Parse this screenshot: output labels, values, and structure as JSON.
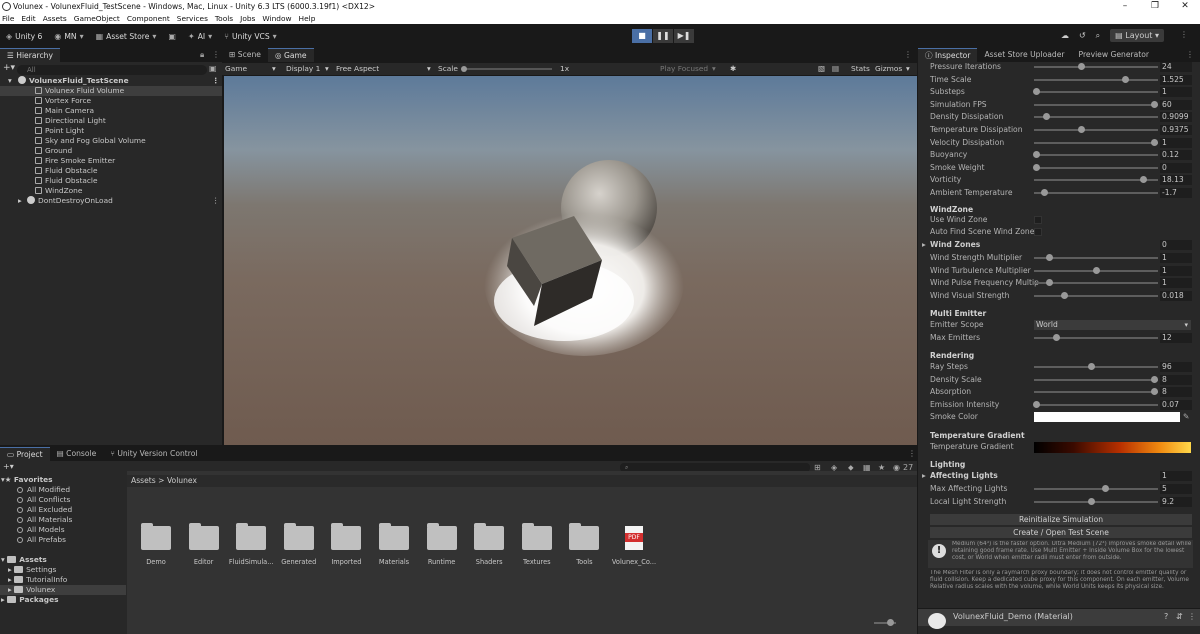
{
  "window": {
    "title": "Volunex - VolunexFluid_TestScene - Windows, Mac, Linux - Unity 6.3 LTS (6000.3.19f1) <DX12>"
  },
  "menu": [
    "File",
    "Edit",
    "Assets",
    "GameObject",
    "Component",
    "Services",
    "Tools",
    "Jobs",
    "Window",
    "Help"
  ],
  "toolbar": {
    "unity": "Unity 6",
    "account": "MN",
    "asset_store": "Asset Store",
    "ai": "AI",
    "vcs": "Unity VCS",
    "layout": "Layout"
  },
  "hierarchy": {
    "tab": "Hierarchy",
    "search_placeholder": "All",
    "scene": "VolunexFluid_TestScene",
    "items": [
      "Volunex Fluid Volume",
      "Vortex Force",
      "Main Camera",
      "Directional Light",
      "Point Light",
      "Sky and Fog Global Volume",
      "Ground",
      "Fire Smoke Emitter",
      "Fluid Obstacle",
      "Fluid Obstacle",
      "WindZone"
    ],
    "dontdestroy": "DontDestroyOnLoad"
  },
  "scene_tabs": {
    "scene": "Scene",
    "game": "Game"
  },
  "gamebar": {
    "game": "Game",
    "display": "Display 1",
    "aspect": "Free Aspect",
    "scale_label": "Scale",
    "scale_value": "1x",
    "play_focused": "Play Focused",
    "stats": "Stats",
    "gizmos": "Gizmos"
  },
  "project": {
    "tabs": [
      "Project",
      "Console",
      "Unity Version Control"
    ],
    "favorites_label": "Favorites",
    "favorites": [
      "All Modified",
      "All Conflicts",
      "All Excluded",
      "All Materials",
      "All Models",
      "All Prefabs"
    ],
    "assets_label": "Assets",
    "asset_children": [
      "Settings",
      "TutorialInfo",
      "Volunex"
    ],
    "packages_label": "Packages",
    "breadcrumb_root": "Assets",
    "breadcrumb_sep": ">",
    "breadcrumb_leaf": "Volunex",
    "folders": [
      "Demo",
      "Editor",
      "FluidSimula...",
      "Generated",
      "Imported",
      "Materials",
      "Runtime",
      "Shaders",
      "Textures",
      "Tools"
    ],
    "pdf": "Volunex_Co...",
    "pdf_badge": "PDF",
    "hidden_count": "27"
  },
  "inspector": {
    "tabs": [
      "Inspector",
      "Asset Store Uploader",
      "Preview Generator"
    ],
    "rows1": [
      {
        "label": "Pressure Iterations",
        "value": "24",
        "pos": 0.38
      },
      {
        "label": "Time Scale",
        "value": "1.525",
        "pos": 0.73
      },
      {
        "label": "Substeps",
        "value": "1",
        "pos": 0.02
      },
      {
        "label": "Simulation FPS",
        "value": "60",
        "pos": 0.97
      },
      {
        "label": "Density Dissipation",
        "value": "0.9099",
        "pos": 0.1
      },
      {
        "label": "Temperature Dissipation",
        "value": "0.9375",
        "pos": 0.38
      },
      {
        "label": "Velocity Dissipation",
        "value": "1",
        "pos": 0.97
      },
      {
        "label": "Buoyancy",
        "value": "0.12",
        "pos": 0.02
      },
      {
        "label": "Smoke Weight",
        "value": "0",
        "pos": 0.02
      },
      {
        "label": "Vorticity",
        "value": "18.13",
        "pos": 0.88
      },
      {
        "label": "Ambient Temperature",
        "value": "-1.7",
        "pos": 0.08
      }
    ],
    "windzone_title": "WindZone",
    "use_wind_zone": "Use Wind Zone",
    "auto_find": "Auto Find Scene Wind Zones",
    "wind_zones": {
      "label": "Wind Zones",
      "value": "0"
    },
    "rows2": [
      {
        "label": "Wind Strength Multiplier",
        "value": "1",
        "pos": 0.12
      },
      {
        "label": "Wind Turbulence Multiplier",
        "value": "1",
        "pos": 0.5
      },
      {
        "label": "Wind Pulse Frequency Multip",
        "value": "1",
        "pos": 0.12
      },
      {
        "label": "Wind Visual Strength",
        "value": "0.018",
        "pos": 0.24
      }
    ],
    "multi_title": "Multi Emitter",
    "emitter_scope": {
      "label": "Emitter Scope",
      "value": "World"
    },
    "max_emitters": {
      "label": "Max Emitters",
      "value": "12",
      "pos": 0.18
    },
    "render_title": "Rendering",
    "rows3": [
      {
        "label": "Ray Steps",
        "value": "96",
        "pos": 0.46
      },
      {
        "label": "Density Scale",
        "value": "8",
        "pos": 0.97
      },
      {
        "label": "Absorption",
        "value": "8",
        "pos": 0.97
      },
      {
        "label": "Emission Intensity",
        "value": "0.07",
        "pos": 0.02
      }
    ],
    "smoke_color": {
      "label": "Smoke Color",
      "color": "#ffffff"
    },
    "gradient_title": "Temperature Gradient",
    "gradient_label": "Temperature Gradient",
    "lighting_title": "Lighting",
    "affecting": {
      "label": "Affecting Lights",
      "value": "1"
    },
    "rows4": [
      {
        "label": "Max Affecting Lights",
        "value": "5",
        "pos": 0.57
      },
      {
        "label": "Local Light Strength",
        "value": "9.2",
        "pos": 0.46
      }
    ],
    "btn_reinit": "Reinitialize Simulation",
    "btn_create": "Create / Open Test Scene",
    "help1": "Medium (64³) is the faster option. Ultra Medium (72³) improves smoke detail while retaining good frame rate. Use Multi Emitter + Inside Volume Box for the lowest cost, or World when emitter radii must enter from outside.",
    "help2": "The Mesh Filter is only a raymarch proxy boundary; it does not control emitter quality or fluid collision. Keep a dedicated cube proxy for this component. On each emitter, Volume Relative radius scales with the volume, while World Units keeps its physical size.",
    "material": "VolunexFluid_Demo (Material)"
  }
}
